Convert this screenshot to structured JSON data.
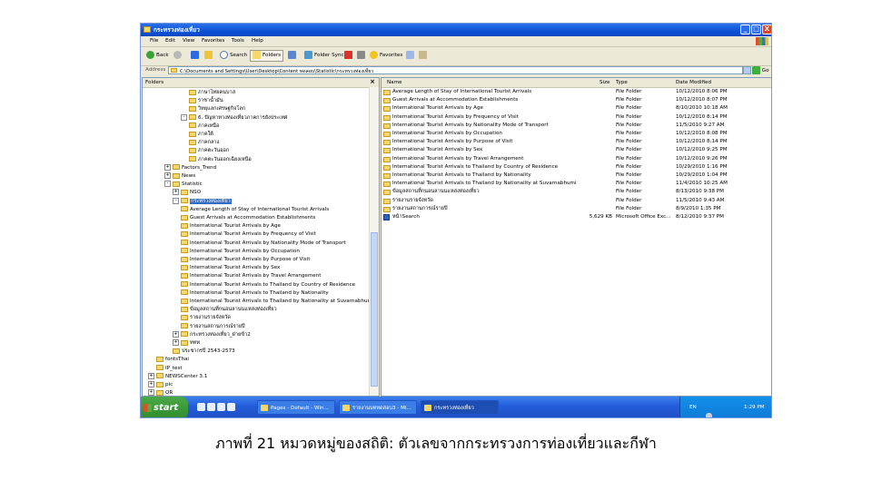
{
  "window": {
    "title": "กระทรวงท่องเที่ยว",
    "controls": [
      "_",
      "□",
      "X"
    ]
  },
  "menu": [
    "File",
    "Edit",
    "View",
    "Favorites",
    "Tools",
    "Help"
  ],
  "toolbar": {
    "back": "Back",
    "search": "Search",
    "folders": "Folders",
    "folder_sync": "Folder Sync",
    "favorites": "Favorites"
  },
  "address": {
    "label": "Address",
    "path": "C:\\Documents and Settings\\User\\Desktop\\Content ทดสอบ\\Statistic\\กระทรวงท่องเที่ยว",
    "go": "Go"
  },
  "folders_pane": {
    "title": "Folders",
    "close": "×",
    "items": [
      {
        "label": "ภาษาไทยคนบาส",
        "indent": 5,
        "exp": ""
      },
      {
        "label": "ราชาน้ำมัน",
        "indent": 5,
        "exp": ""
      },
      {
        "label": "วิทยุแลกเศรษฐกิจโลก",
        "indent": 5,
        "exp": ""
      },
      {
        "label": "6. ปัญหาทางท่องเที่ยวภาคการยังประเทศ",
        "indent": 4,
        "exp": "-"
      },
      {
        "label": "ภาคเหนือ",
        "indent": 5,
        "exp": ""
      },
      {
        "label": "ภาคใต้",
        "indent": 5,
        "exp": ""
      },
      {
        "label": "ภาคกลาง",
        "indent": 5,
        "exp": ""
      },
      {
        "label": "ภาคตะวันออก",
        "indent": 5,
        "exp": ""
      },
      {
        "label": "ภาคตะวันออกเฉียงเหนือ",
        "indent": 5,
        "exp": ""
      },
      {
        "label": "Factors_Trend",
        "indent": 2,
        "exp": "+"
      },
      {
        "label": "News",
        "indent": 2,
        "exp": "+"
      },
      {
        "label": "Statistic",
        "indent": 2,
        "exp": "-"
      },
      {
        "label": "NSO",
        "indent": 3,
        "exp": "+"
      },
      {
        "label": "กระทรวงท่องเที่ยว",
        "indent": 3,
        "exp": "-",
        "selected": true
      },
      {
        "label": "Average Length of Stay of International Tourist Arrivals",
        "indent": 4,
        "exp": ""
      },
      {
        "label": "Guest Arrivals at Accommodation Establishments",
        "indent": 4,
        "exp": ""
      },
      {
        "label": "International Tourist Arrivals by Age",
        "indent": 4,
        "exp": ""
      },
      {
        "label": "International Tourist Arrivals by Frequency of Visit",
        "indent": 4,
        "exp": ""
      },
      {
        "label": "International Tourist Arrivals by Nationality Mode of Transport",
        "indent": 4,
        "exp": ""
      },
      {
        "label": "International Tourist Arrivals by Occupation",
        "indent": 4,
        "exp": ""
      },
      {
        "label": "International Tourist Arrivals by Purpose of Visit",
        "indent": 4,
        "exp": ""
      },
      {
        "label": "International Tourist Arrivals by Sex",
        "indent": 4,
        "exp": ""
      },
      {
        "label": "International Tourist Arrivals by Travel Arrangement",
        "indent": 4,
        "exp": ""
      },
      {
        "label": "International Tourist Arrivals to Thailand by Country of Residence",
        "indent": 4,
        "exp": ""
      },
      {
        "label": "International Tourist Arrivals to Thailand by Nationality",
        "indent": 4,
        "exp": ""
      },
      {
        "label": "International Tourist Arrivals to Thailand by Nationality at Suvarnabhumi",
        "indent": 4,
        "exp": ""
      },
      {
        "label": "ข้อมูลสถานที่กนอนลานนแหล่งท่องเที่ยว",
        "indent": 4,
        "exp": ""
      },
      {
        "label": "รายงานรายจังหวัด",
        "indent": 4,
        "exp": ""
      },
      {
        "label": "รายงานสถานการณ์รายปี",
        "indent": 4,
        "exp": ""
      },
      {
        "label": "กระทรวงท่องเที่ยว_ฝ่ายข้า2",
        "indent": 3,
        "exp": "+"
      },
      {
        "label": "ททท",
        "indent": 3,
        "exp": "+"
      },
      {
        "label": "ประชากรปี 2543-2573",
        "indent": 3,
        "exp": ""
      },
      {
        "label": "fontsThai",
        "indent": 1,
        "exp": ""
      },
      {
        "label": "IP_test",
        "indent": 1,
        "exp": ""
      },
      {
        "label": "NEWSCenter 3.1",
        "indent": 0,
        "exp": "+"
      },
      {
        "label": "pic",
        "indent": 0,
        "exp": "+"
      },
      {
        "label": "QR",
        "indent": 0,
        "exp": "+"
      }
    ]
  },
  "list_pane": {
    "columns": {
      "name": "Name",
      "size": "Size",
      "type": "Type",
      "date": "Date Modified"
    },
    "rows": [
      {
        "name": "Average Length of Stay of International Tourist Arrivals",
        "size": "",
        "type": "File Folder",
        "date": "10/12/2010 8:06 PM",
        "kind": "folder"
      },
      {
        "name": "Guest Arrivals at Accommodation Establishments",
        "size": "",
        "type": "File Folder",
        "date": "10/12/2010 8:07 PM",
        "kind": "folder"
      },
      {
        "name": "International Tourist Arrivals by Age",
        "size": "",
        "type": "File Folder",
        "date": "8/10/2010 10:18 AM",
        "kind": "folder"
      },
      {
        "name": "International Tourist Arrivals by Frequency of Visit",
        "size": "",
        "type": "File Folder",
        "date": "10/12/2010 8:14 PM",
        "kind": "folder"
      },
      {
        "name": "International Tourist Arrivals by Nationality Mode of Transport",
        "size": "",
        "type": "File Folder",
        "date": "11/5/2010 9:27 AM",
        "kind": "folder"
      },
      {
        "name": "International Tourist Arrivals by Occupation",
        "size": "",
        "type": "File Folder",
        "date": "10/12/2010 8:08 PM",
        "kind": "folder"
      },
      {
        "name": "International Tourist Arrivals by Purpose of Visit",
        "size": "",
        "type": "File Folder",
        "date": "10/12/2010 8:14 PM",
        "kind": "folder"
      },
      {
        "name": "International Tourist Arrivals by Sex",
        "size": "",
        "type": "File Folder",
        "date": "10/12/2010 9:25 PM",
        "kind": "folder"
      },
      {
        "name": "International Tourist Arrivals by Travel Arrangement",
        "size": "",
        "type": "File Folder",
        "date": "10/12/2010 9:26 PM",
        "kind": "folder"
      },
      {
        "name": "International Tourist Arrivals to Thailand by Country of Residence",
        "size": "",
        "type": "File Folder",
        "date": "10/29/2010 1:16 PM",
        "kind": "folder"
      },
      {
        "name": "International Tourist Arrivals to Thailand by Nationality",
        "size": "",
        "type": "File Folder",
        "date": "10/29/2010 1:04 PM",
        "kind": "folder"
      },
      {
        "name": "International Tourist Arrivals to Thailand by Nationality at Suvarnabhumi",
        "size": "",
        "type": "File Folder",
        "date": "11/4/2010 10:25 AM",
        "kind": "folder"
      },
      {
        "name": "ข้อมูลสถานที่กนอนลานนแหล่งท่องเที่ยว",
        "size": "",
        "type": "File Folder",
        "date": "8/13/2010 9:38 PM",
        "kind": "folder"
      },
      {
        "name": "รายงานรายจังหวัด",
        "size": "",
        "type": "File Folder",
        "date": "11/5/2010 9:43 AM",
        "kind": "folder"
      },
      {
        "name": "รายงานสถานการณ์รายปี",
        "size": "",
        "type": "File Folder",
        "date": "8/9/2010 1:35 PM",
        "kind": "folder"
      },
      {
        "name": "หน้าSearch",
        "size": "5,629 KB",
        "type": "Microsoft Office Exc...",
        "date": "8/12/2010 9:37 PM",
        "kind": "doc"
      }
    ]
  },
  "taskbar": {
    "start": "start",
    "tasks": [
      {
        "label": "Pages - Default - Win...",
        "active": false
      },
      {
        "label": "รายงานบททดสอบ3 - Mi...",
        "active": false
      },
      {
        "label": "กระทรวงท่องเที่ยว",
        "active": true
      }
    ],
    "tray": {
      "lang": "EN",
      "time": "1:29 PM"
    }
  },
  "caption": "ภาพที่ 21 หมวดหมู่ของสถิติ: ตัวเลขจากกระทรวงการท่องเที่ยวและกีฬา"
}
